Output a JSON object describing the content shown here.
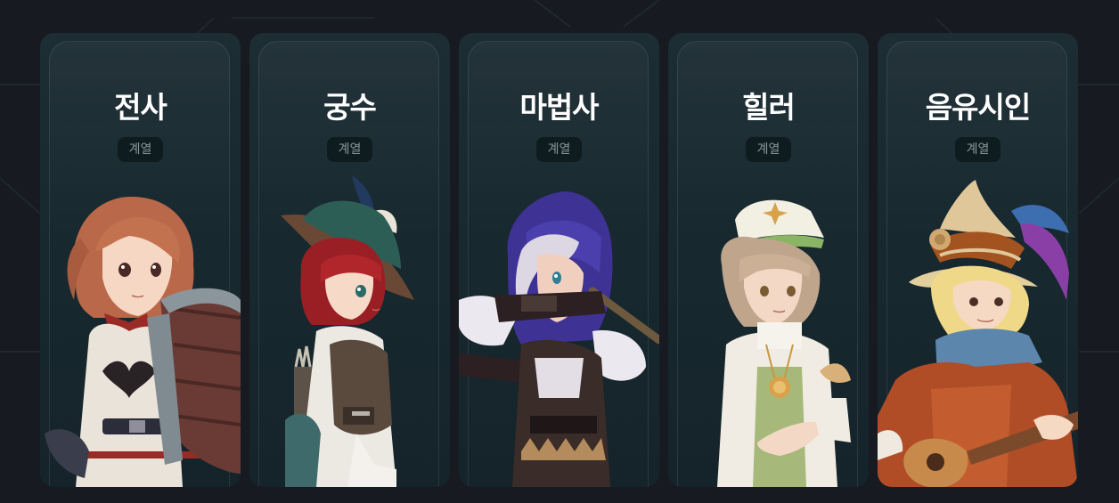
{
  "badge_label": "계열",
  "classes": [
    {
      "title": "전사"
    },
    {
      "title": "궁수"
    },
    {
      "title": "마법사"
    },
    {
      "title": "힐러"
    },
    {
      "title": "음유시인"
    }
  ]
}
